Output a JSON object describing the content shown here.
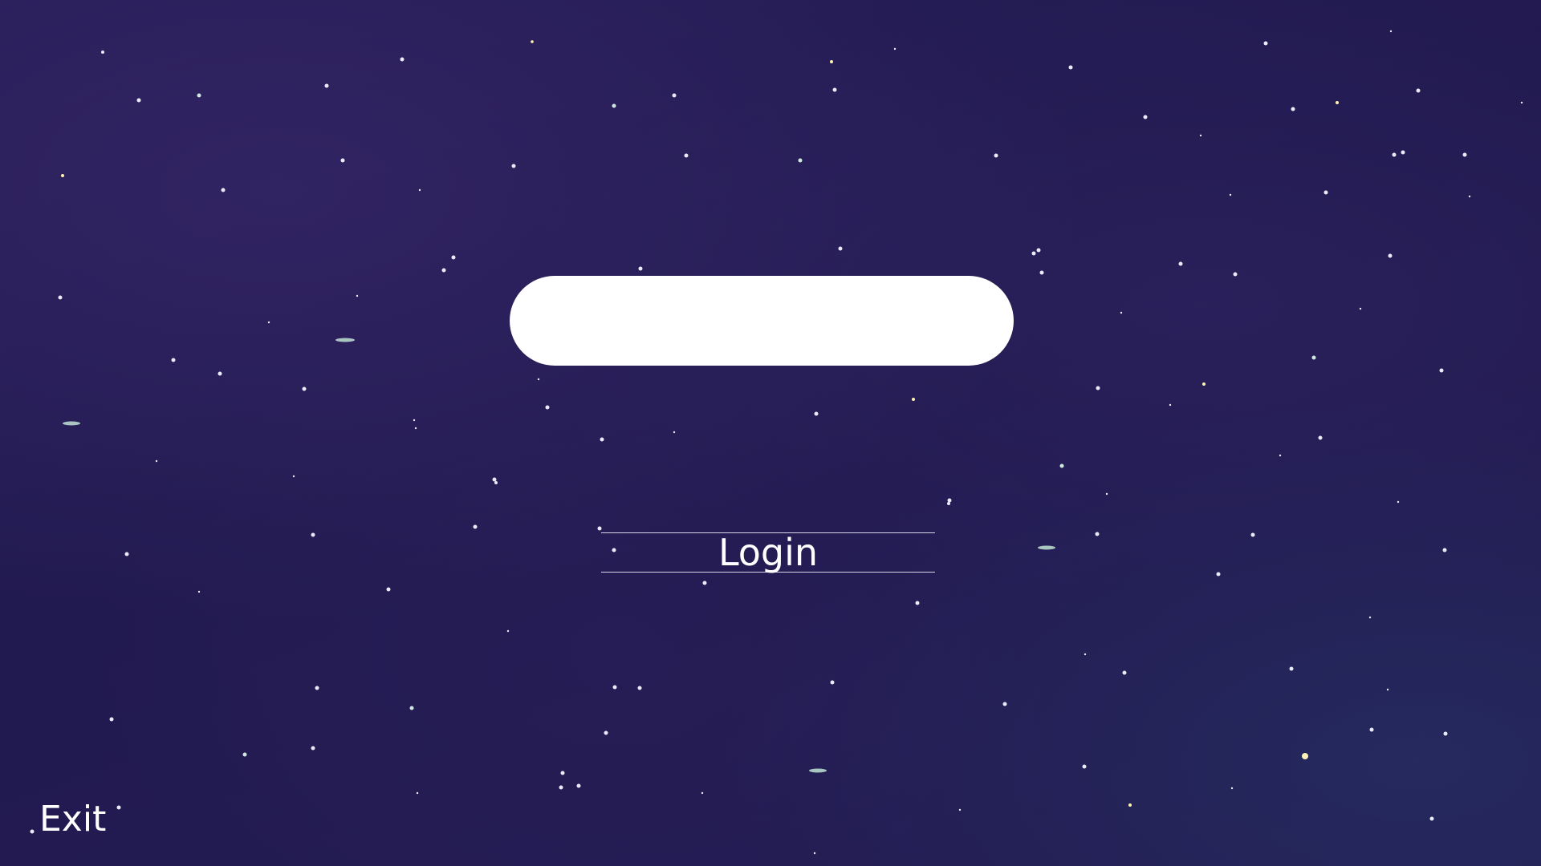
{
  "login_screen": {
    "name_input_value": "",
    "login_label": "Login",
    "exit_label": "Exit"
  },
  "theme": {
    "background": "#221b4f",
    "input_background": "#ffffff",
    "text_color": "#ffffff"
  }
}
